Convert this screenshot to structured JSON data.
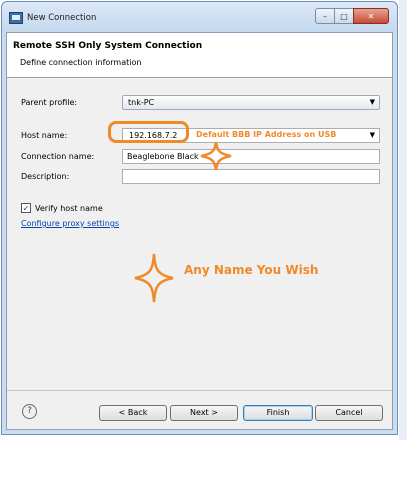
{
  "window": {
    "title": "New Connection",
    "min_glyph": "–",
    "max_glyph": "□",
    "close_glyph": "✕"
  },
  "header": {
    "title": "Remote SSH Only System Connection",
    "subtitle": "Define connection information"
  },
  "form": {
    "parent_profile_label": "Parent profile:",
    "parent_profile_value": "tnk-PC",
    "host_name_label": "Host name:",
    "host_name_value": "192.168.7.2",
    "connection_name_label": "Connection name:",
    "connection_name_value": "Beaglebone Black",
    "description_label": "Description:",
    "description_value": "",
    "verify_host_label": "Verify host name",
    "verify_host_checked": true,
    "proxy_link": "Configure proxy settings"
  },
  "buttons": {
    "help": "?",
    "back": "< Back",
    "next": "Next >",
    "finish": "Finish",
    "cancel": "Cancel"
  },
  "annotations": {
    "host_note": "Default BBB IP Address on USB",
    "name_note": "Any Name You Wish",
    "color": "#f08a28"
  }
}
